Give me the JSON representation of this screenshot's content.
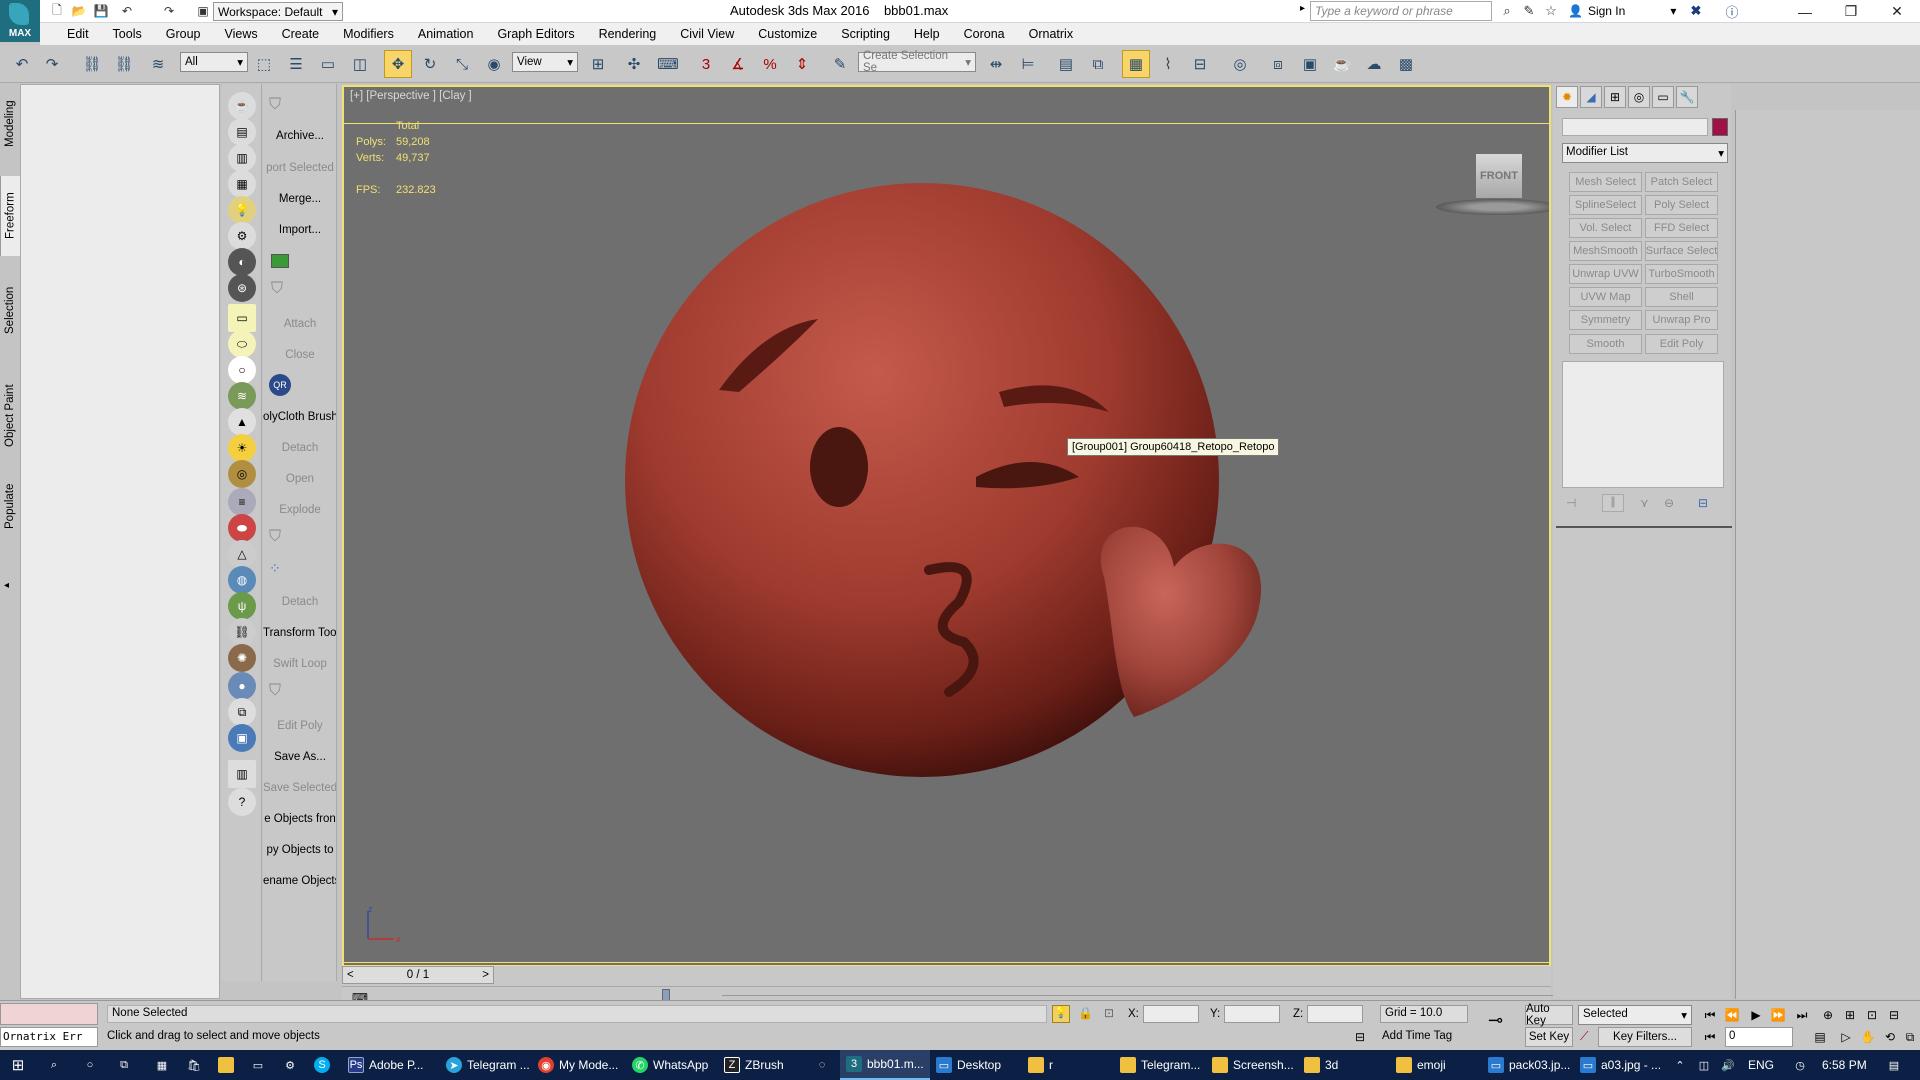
{
  "app": {
    "logo_text": "MAX",
    "title": "Autodesk 3ds Max 2016",
    "file": "bbb01.max",
    "workspace": "Workspace: Default",
    "search_placeholder": "Type a keyword or phrase",
    "sign_in": "Sign In"
  },
  "menu": [
    "Edit",
    "Tools",
    "Group",
    "Views",
    "Create",
    "Modifiers",
    "Animation",
    "Graph Editors",
    "Rendering",
    "Civil View",
    "Customize",
    "Scripting",
    "Help",
    "Corona",
    "Ornatrix"
  ],
  "toolbar": {
    "filter": "All",
    "ref_coord": "View",
    "selection_set_placeholder": "Create Selection Se",
    "snap_label": "3"
  },
  "left_tabs": [
    "Modeling",
    "Freeform",
    "Selection",
    "Object Paint",
    "Populate"
  ],
  "side_labels": [
    {
      "text": "Archive...",
      "disabled": false
    },
    {
      "text": "port Selected",
      "disabled": true
    },
    {
      "text": "Merge...",
      "disabled": false
    },
    {
      "text": "Import...",
      "disabled": false
    },
    {
      "text": "",
      "disabled": false
    },
    {
      "text": "",
      "disabled": false
    },
    {
      "text": "Attach",
      "disabled": true
    },
    {
      "text": "Close",
      "disabled": true
    },
    {
      "text": "",
      "disabled": false
    },
    {
      "text": "olyCloth Brush",
      "disabled": false
    },
    {
      "text": "Detach",
      "disabled": true
    },
    {
      "text": "Open",
      "disabled": true
    },
    {
      "text": "Explode",
      "disabled": true
    },
    {
      "text": "",
      "disabled": false
    },
    {
      "text": "",
      "disabled": false
    },
    {
      "text": "Detach",
      "disabled": true
    },
    {
      "text": "Transform Tool",
      "disabled": false
    },
    {
      "text": "Swift Loop",
      "disabled": true
    },
    {
      "text": "",
      "disabled": false
    },
    {
      "text": "Edit Poly",
      "disabled": true
    },
    {
      "text": "Save As...",
      "disabled": false
    },
    {
      "text": "Save Selected",
      "disabled": true
    },
    {
      "text": "e Objects fron",
      "disabled": false
    },
    {
      "text": "py Objects to",
      "disabled": false
    },
    {
      "text": "ename Objects",
      "disabled": false
    }
  ],
  "viewport": {
    "label": "[+] [Perspective ] [Clay ]",
    "stats_header": "Total",
    "polys_label": "Polys:",
    "polys": "59,208",
    "verts_label": "Verts:",
    "verts": "49,737",
    "fps_label": "FPS:",
    "fps": "232.823",
    "tooltip": "[Group001] Group60418_Retopo_Retopo",
    "viewcube_face": "FRONT",
    "axis_z": "z",
    "axis_x": "x"
  },
  "timeslider": {
    "frame": "0 / 1",
    "prev": "<",
    "next": ">"
  },
  "command_panel": {
    "modifier_list": "Modifier List",
    "color": "#a01247",
    "modifiers": [
      [
        "Mesh Select",
        "Patch Select"
      ],
      [
        "SplineSelect",
        "Poly Select"
      ],
      [
        "Vol. Select",
        "FFD Select"
      ],
      [
        "MeshSmooth",
        "Surface Select"
      ],
      [
        "Unwrap UVW",
        "TurboSmooth"
      ],
      [
        "UVW Map",
        "Shell"
      ],
      [
        "Symmetry",
        "Unwrap Pro"
      ],
      [
        "Smooth",
        "Edit Poly"
      ]
    ]
  },
  "status": {
    "maxscript": "Ornatrix Err",
    "selection": "None Selected",
    "prompt": "Click and drag to select and move objects",
    "x_label": "X:",
    "y_label": "Y:",
    "z_label": "Z:",
    "grid": "Grid = 10.0",
    "add_time_tag": "Add Time Tag",
    "auto_key": "Auto Key",
    "set_key": "Set Key",
    "selected": "Selected",
    "key_filters": "Key Filters...",
    "frame": "0"
  },
  "taskbar": {
    "items": [
      "Adobe P...",
      "Telegram ...",
      "My Mode...",
      "WhatsApp",
      "ZBrush",
      "bbb01.m...",
      "Desktop",
      "r",
      "Telegram...",
      "Screensh...",
      "3d",
      "emoji",
      "pack03.jp...",
      "a03.jpg - ..."
    ],
    "lang": "ENG",
    "time": "6:58 PM"
  }
}
